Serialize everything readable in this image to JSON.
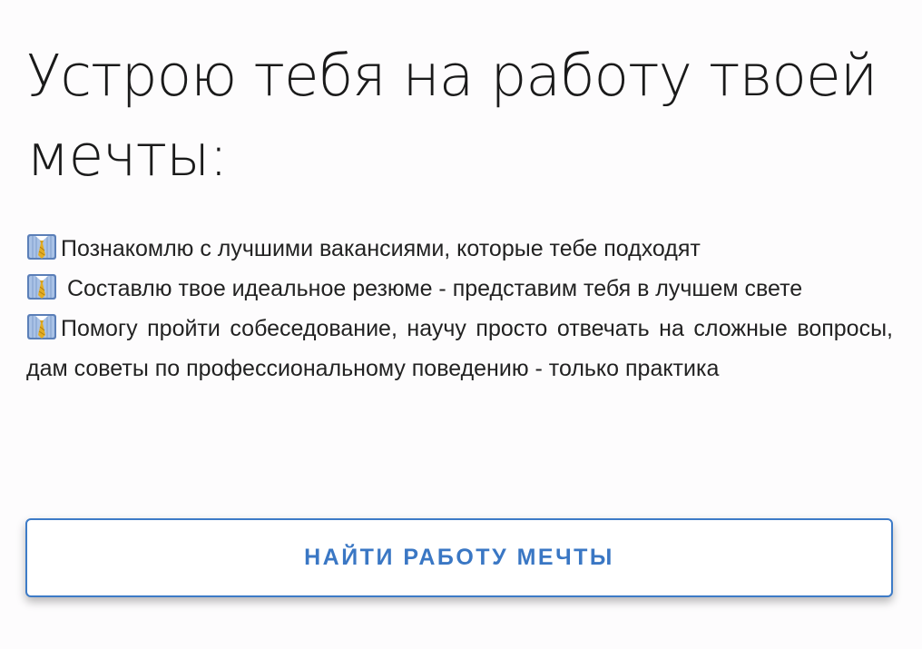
{
  "heading": "Устрою тебя на работу твоей мечты:",
  "features": [
    {
      "icon": "necktie-shirt-icon",
      "text": "Познакомлю с лучшими вакансиями, которые тебе подходят"
    },
    {
      "icon": "necktie-shirt-icon",
      "text": " Составлю твое идеальное резюме - представим тебя в лучшем свете"
    },
    {
      "icon": "necktie-shirt-icon",
      "text": "Помогу пройти собеседование, научу просто отвечать на сложные вопросы, дам советы по профессиональному поведению - только практика"
    }
  ],
  "cta": {
    "label": "НАЙТИ РАБОТУ МЕЧТЫ"
  },
  "colors": {
    "accent": "#3a77c4",
    "text": "#1e1e1e",
    "background": "#fdfcfd"
  }
}
